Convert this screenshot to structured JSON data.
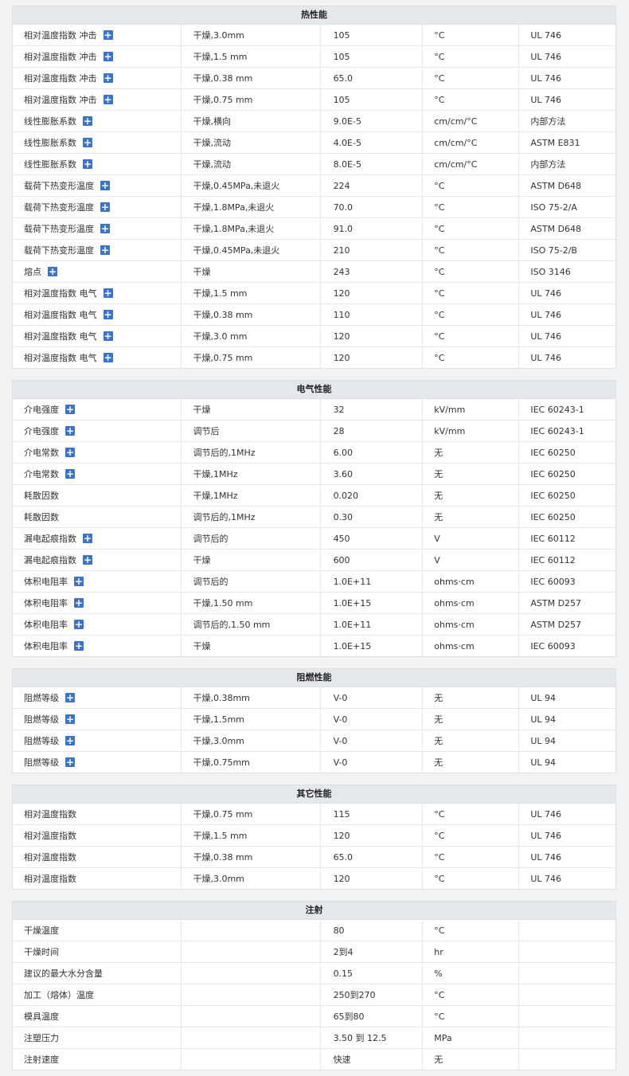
{
  "sections": [
    {
      "title": "热性能",
      "rows": [
        {
          "name": "相对温度指数 冲击",
          "info": true,
          "condition": "干燥,3.0mm",
          "value": "105",
          "unit": "°C",
          "method": "UL 746"
        },
        {
          "name": "相对温度指数 冲击",
          "info": true,
          "condition": "干燥,1.5 mm",
          "value": "105",
          "unit": "°C",
          "method": "UL 746"
        },
        {
          "name": "相对温度指数 冲击",
          "info": true,
          "condition": "干燥,0.38 mm",
          "value": "65.0",
          "unit": "°C",
          "method": "UL 746"
        },
        {
          "name": "相对温度指数 冲击",
          "info": true,
          "condition": "干燥,0.75 mm",
          "value": "105",
          "unit": "°C",
          "method": "UL 746"
        },
        {
          "name": "线性膨胀系数",
          "info": true,
          "condition": "干燥,横向",
          "value": "9.0E-5",
          "unit": "cm/cm/°C",
          "method": "内部方法"
        },
        {
          "name": "线性膨胀系数",
          "info": true,
          "condition": "干燥,流动",
          "value": "4.0E-5",
          "unit": "cm/cm/°C",
          "method": "ASTM E831"
        },
        {
          "name": "线性膨胀系数",
          "info": true,
          "condition": "干燥,流动",
          "value": "8.0E-5",
          "unit": "cm/cm/°C",
          "method": "内部方法"
        },
        {
          "name": "载荷下热变形温度",
          "info": true,
          "condition": "干燥,0.45MPa,未退火",
          "value": "224",
          "unit": "°C",
          "method": "ASTM D648"
        },
        {
          "name": "载荷下热变形温度",
          "info": true,
          "condition": "干燥,1.8MPa,未退火",
          "value": "70.0",
          "unit": "°C",
          "method": "ISO 75-2/A"
        },
        {
          "name": "载荷下热变形温度",
          "info": true,
          "condition": "干燥,1.8MPa,未退火",
          "value": "91.0",
          "unit": "°C",
          "method": "ASTM D648"
        },
        {
          "name": "载荷下热变形温度",
          "info": true,
          "condition": "干燥,0.45MPa,未退火",
          "value": "210",
          "unit": "°C",
          "method": "ISO 75-2/B"
        },
        {
          "name": "熔点",
          "info": true,
          "condition": "干燥",
          "value": "243",
          "unit": "°C",
          "method": "ISO 3146"
        },
        {
          "name": "相对温度指数 电气",
          "info": true,
          "condition": "干燥,1.5 mm",
          "value": "120",
          "unit": "°C",
          "method": "UL 746"
        },
        {
          "name": "相对温度指数 电气",
          "info": true,
          "condition": "干燥,0.38 mm",
          "value": "110",
          "unit": "°C",
          "method": "UL 746"
        },
        {
          "name": "相对温度指数 电气",
          "info": true,
          "condition": "干燥,3.0 mm",
          "value": "120",
          "unit": "°C",
          "method": "UL 746"
        },
        {
          "name": "相对温度指数 电气",
          "info": true,
          "condition": "干燥,0.75 mm",
          "value": "120",
          "unit": "°C",
          "method": "UL 746"
        }
      ]
    },
    {
      "title": "电气性能",
      "rows": [
        {
          "name": "介电强度",
          "info": true,
          "condition": "干燥",
          "value": "32",
          "unit": "kV/mm",
          "method": "IEC 60243-1"
        },
        {
          "name": "介电强度",
          "info": true,
          "condition": "调节后",
          "value": "28",
          "unit": "kV/mm",
          "method": "IEC 60243-1"
        },
        {
          "name": "介电常数",
          "info": true,
          "condition": "调节后的,1MHz",
          "value": "6.00",
          "unit": "无",
          "method": "IEC 60250"
        },
        {
          "name": "介电常数",
          "info": true,
          "condition": "干燥,1MHz",
          "value": "3.60",
          "unit": "无",
          "method": "IEC 60250"
        },
        {
          "name": "耗散因数",
          "info": false,
          "condition": "干燥,1MHz",
          "value": "0.020",
          "unit": "无",
          "method": "IEC 60250"
        },
        {
          "name": "耗散因数",
          "info": false,
          "condition": "调节后的,1MHz",
          "value": "0.30",
          "unit": "无",
          "method": "IEC 60250"
        },
        {
          "name": "漏电起痕指数",
          "info": true,
          "condition": "调节后的",
          "value": "450",
          "unit": "V",
          "method": "IEC 60112"
        },
        {
          "name": "漏电起痕指数",
          "info": true,
          "condition": "干燥",
          "value": "600",
          "unit": "V",
          "method": "IEC 60112"
        },
        {
          "name": "体积电阻率",
          "info": true,
          "condition": "调节后的",
          "value": "1.0E+11",
          "unit": "ohms·cm",
          "method": "IEC 60093"
        },
        {
          "name": "体积电阻率",
          "info": true,
          "condition": "干燥,1.50 mm",
          "value": "1.0E+15",
          "unit": "ohms·cm",
          "method": "ASTM D257"
        },
        {
          "name": "体积电阻率",
          "info": true,
          "condition": "调节后的,1.50 mm",
          "value": "1.0E+11",
          "unit": "ohms·cm",
          "method": "ASTM D257"
        },
        {
          "name": "体积电阻率",
          "info": true,
          "condition": "干燥",
          "value": "1.0E+15",
          "unit": "ohms·cm",
          "method": "IEC 60093"
        }
      ]
    },
    {
      "title": "阻燃性能",
      "rows": [
        {
          "name": "阻燃等级",
          "info": true,
          "condition": "干燥,0.38mm",
          "value": "V-0",
          "unit": "无",
          "method": "UL 94"
        },
        {
          "name": "阻燃等级",
          "info": true,
          "condition": "干燥,1.5mm",
          "value": "V-0",
          "unit": "无",
          "method": "UL 94"
        },
        {
          "name": "阻燃等级",
          "info": true,
          "condition": "干燥,3.0mm",
          "value": "V-0",
          "unit": "无",
          "method": "UL 94"
        },
        {
          "name": "阻燃等级",
          "info": true,
          "condition": "干燥,0.75mm",
          "value": "V-0",
          "unit": "无",
          "method": "UL 94"
        }
      ]
    },
    {
      "title": "其它性能",
      "rows": [
        {
          "name": "相对温度指数",
          "info": false,
          "condition": "干燥,0.75 mm",
          "value": "115",
          "unit": "°C",
          "method": "UL 746"
        },
        {
          "name": "相对温度指数",
          "info": false,
          "condition": "干燥,1.5 mm",
          "value": "120",
          "unit": "°C",
          "method": "UL 746"
        },
        {
          "name": "相对温度指数",
          "info": false,
          "condition": "干燥,0.38 mm",
          "value": "65.0",
          "unit": "°C",
          "method": "UL 746"
        },
        {
          "name": "相对温度指数",
          "info": false,
          "condition": "干燥,3.0mm",
          "value": "120",
          "unit": "°C",
          "method": "UL 746"
        }
      ]
    },
    {
      "title": "注射",
      "rows": [
        {
          "name": "干燥温度",
          "info": false,
          "condition": "",
          "value": "80",
          "unit": "°C",
          "method": ""
        },
        {
          "name": "干燥时间",
          "info": false,
          "condition": "",
          "value": "2到4",
          "unit": "hr",
          "method": ""
        },
        {
          "name": "建议的最大水分含量",
          "info": false,
          "condition": "",
          "value": "0.15",
          "unit": "%",
          "method": ""
        },
        {
          "name": "加工（熔体）温度",
          "info": false,
          "condition": "",
          "value": "250到270",
          "unit": "°C",
          "method": ""
        },
        {
          "name": "模具温度",
          "info": false,
          "condition": "",
          "value": "65到80",
          "unit": "°C",
          "method": ""
        },
        {
          "name": "注塑压力",
          "info": false,
          "condition": "",
          "value": "3.50 到 12.5",
          "unit": "MPa",
          "method": ""
        },
        {
          "name": "注射速度",
          "info": false,
          "condition": "",
          "value": "快速",
          "unit": "无",
          "method": ""
        }
      ]
    }
  ],
  "info_icon": "plus-icon",
  "info_symbol": "+",
  "colors": {
    "accent": "#3b73c8",
    "header_bg": "#e4e7ec",
    "page_bg": "#f1f2f4"
  }
}
